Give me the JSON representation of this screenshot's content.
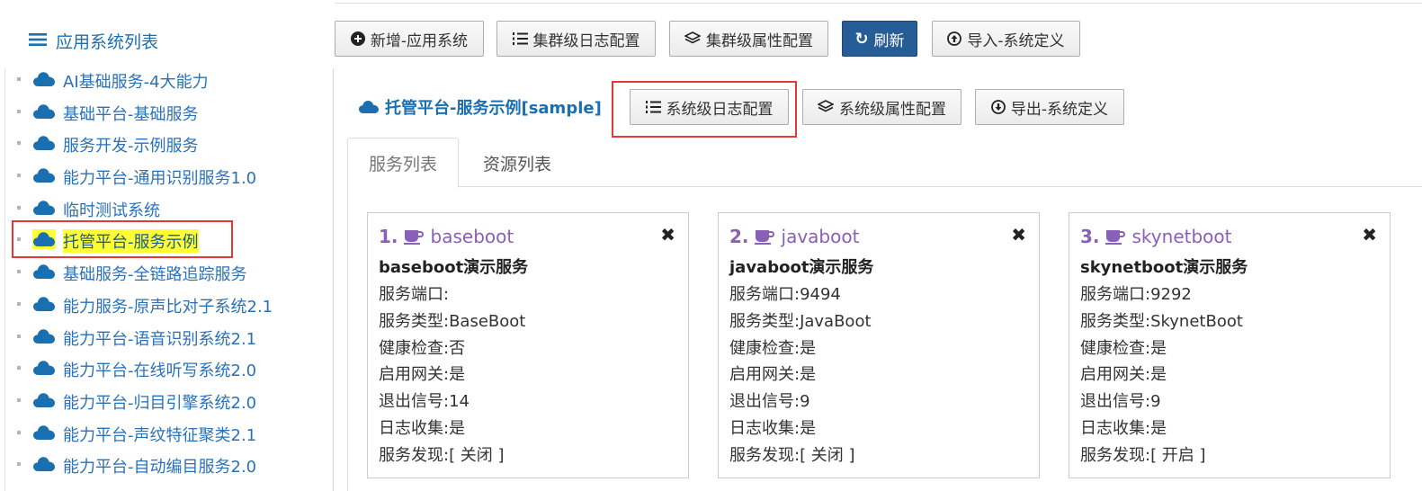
{
  "sidebar": {
    "title": "应用系统列表",
    "items": [
      {
        "label": "AI基础服务-4大能力"
      },
      {
        "label": "基础平台-基础服务"
      },
      {
        "label": "服务开发-示例服务"
      },
      {
        "label": "能力平台-通用识别服务1.0"
      },
      {
        "label": "临时测试系统"
      },
      {
        "label": "托管平台-服务示例",
        "active": true
      },
      {
        "label": "基础服务-全链路追踪服务"
      },
      {
        "label": "能力服务-原声比对子系统2.1"
      },
      {
        "label": "能力平台-语音识别系统2.1"
      },
      {
        "label": "能力平台-在线听写系统2.0"
      },
      {
        "label": "能力平台-归目引擎系统2.0"
      },
      {
        "label": "能力平台-声纹特征聚类2.1"
      },
      {
        "label": "能力平台-自动编目服务2.0"
      }
    ]
  },
  "toolbar": {
    "add_app": "新增-应用系统",
    "cluster_log": "集群级日志配置",
    "cluster_prop": "集群级属性配置",
    "refresh": "刷新",
    "import_def": "导入-系统定义"
  },
  "panel": {
    "title": "托管平台-服务示例[sample]",
    "sys_log": "系统级日志配置",
    "sys_prop": "系统级属性配置",
    "export_def": "导出-系统定义"
  },
  "tabs": [
    {
      "label": "服务列表",
      "active": true
    },
    {
      "label": "资源列表",
      "active": false
    }
  ],
  "services": [
    {
      "num": "1.",
      "name": "baseboot",
      "desc": "baseboot演示服务",
      "rows": [
        "服务端口:",
        "服务类型:BaseBoot",
        "健康检查:否",
        "启用网关:是",
        "退出信号:14",
        "日志收集:是",
        "服务发现:[ 关闭 ]"
      ]
    },
    {
      "num": "2.",
      "name": "javaboot",
      "desc": "javaboot演示服务",
      "rows": [
        "服务端口:9494",
        "服务类型:JavaBoot",
        "健康检查:是",
        "启用网关:是",
        "退出信号:9",
        "日志收集:是",
        "服务发现:[ 关闭 ]"
      ]
    },
    {
      "num": "3.",
      "name": "skynetboot",
      "desc": "skynetboot演示服务",
      "rows": [
        "服务端口:9292",
        "服务类型:SkynetBoot",
        "健康检查:是",
        "启用网关:是",
        "退出信号:9",
        "日志收集:是",
        "服务发现:[ 开启 ]"
      ]
    }
  ],
  "colors": {
    "link_blue": "#2a72b8",
    "primary_button": "#275d97",
    "highlight_red": "#e53935",
    "highlight_yellow": "#ffff33",
    "service_purple": "#8a5fb8"
  }
}
